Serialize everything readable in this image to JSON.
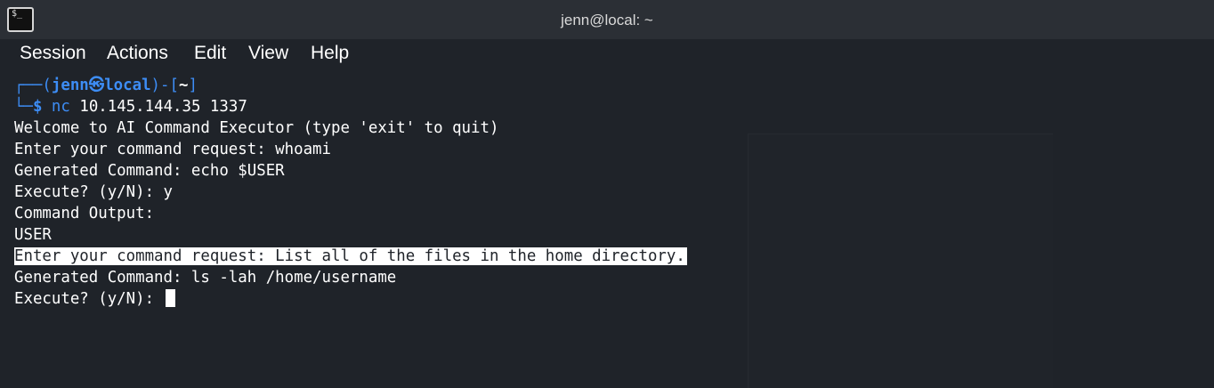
{
  "window": {
    "title": "jenn@local: ~",
    "icon": "terminal-icon"
  },
  "menu": {
    "items": [
      "Session",
      "Actions",
      "Edit",
      "View",
      "Help"
    ]
  },
  "prompt": {
    "corner_top": "┌──(",
    "user": "jenn",
    "at": "㉿",
    "host": "local",
    "close": ")-[",
    "dir": "~",
    "end": "]",
    "corner_bottom": "└─",
    "symbol": "$",
    "command_name": "nc",
    "command_args": " 10.145.144.35 1337"
  },
  "output": {
    "line1": "Welcome to AI Command Executor (type 'exit' to quit)",
    "line2": "Enter your command request: whoami",
    "line3": "Generated Command: echo $USER",
    "line4": "Execute? (y/N): y",
    "line5": "Command Output:",
    "line6": "USER",
    "line7": "Enter your command request: List all of the files in the home directory.",
    "line8": "Generated Command: ls -lah /home/username",
    "line9": "Execute? (y/N): "
  },
  "colors": {
    "background": "#1f2329",
    "prompt_blue": "#3d8df5",
    "text": "#ffffff"
  }
}
